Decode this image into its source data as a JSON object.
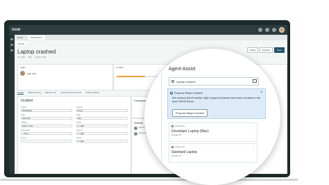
{
  "app": {
    "logo": "now"
  },
  "tabs": [
    {
      "label": "Home"
    },
    {
      "label": "INC0010101"
    },
    {
      "label": ""
    }
  ],
  "record": {
    "subtab": "Details",
    "title": "Laptop crashed",
    "meta": [
      "P2 - High",
      "New",
      "Inquiry / Help"
    ]
  },
  "header_buttons": [
    "Follow",
    "Resolve",
    "Save"
  ],
  "caller": {
    "label": "Caller",
    "name": "Abel Tuter"
  },
  "location": {
    "label": "Location",
    "progress_pct": 55
  },
  "inner_tabs": [
    "Details",
    "Task SLAs (4)",
    "Affected CIs",
    "Impacted Services/CIs",
    "Child Incidents"
  ],
  "incident_form": {
    "title": "Incident",
    "fields": [
      {
        "label": "Number",
        "value": "INC0010101"
      },
      {
        "label": "Channel",
        "value": "Email"
      },
      {
        "label": "Caller",
        "value": "Abel Tuter"
      },
      {
        "label": "State",
        "value": "New"
      },
      {
        "label": "Category",
        "value": "Inquiry / Help"
      },
      {
        "label": "Impact",
        "value": "2 - High"
      },
      {
        "label": "Subcategory",
        "value": "-- None --"
      },
      {
        "label": "Urgency",
        "value": "2 - High"
      },
      {
        "label": "Service",
        "value": ""
      },
      {
        "label": "Priority",
        "value": "2 - High"
      }
    ]
  },
  "compose": {
    "title": "Compose"
  },
  "activity": {
    "title": "Activity",
    "entries": [
      {
        "author": "System Administrator"
      },
      {
        "author": "System Administrator"
      }
    ]
  },
  "agent_assist": {
    "title": "Agent Assist",
    "search_value": "Laptop crashed",
    "suggestion": {
      "heading": "Propose Major Incident",
      "body": "We noticed that 5 similar high impact incidents have been created in the past 24h30 hours.",
      "button": "Propose Major Incident"
    },
    "catalog_items": [
      {
        "type": "Catalog item",
        "name": "Developer Laptop (Mac)",
        "sub": "Standard ITs"
      },
      {
        "type": "Catalog item",
        "name": "Standard Laptop",
        "sub": "Standard ITs"
      }
    ]
  },
  "colors": {
    "laptop_bezel": "#1d2a2c",
    "top_bar": "#2e3c3f",
    "suggestion_bg": "#dcebf7",
    "primary": "#24536b",
    "progress": "#e8a33b"
  },
  "icons": [
    "search-icon",
    "filter-icon",
    "info-icon",
    "close-icon",
    "catalog-icon",
    "more-icon",
    "bell-icon",
    "avatar"
  ]
}
